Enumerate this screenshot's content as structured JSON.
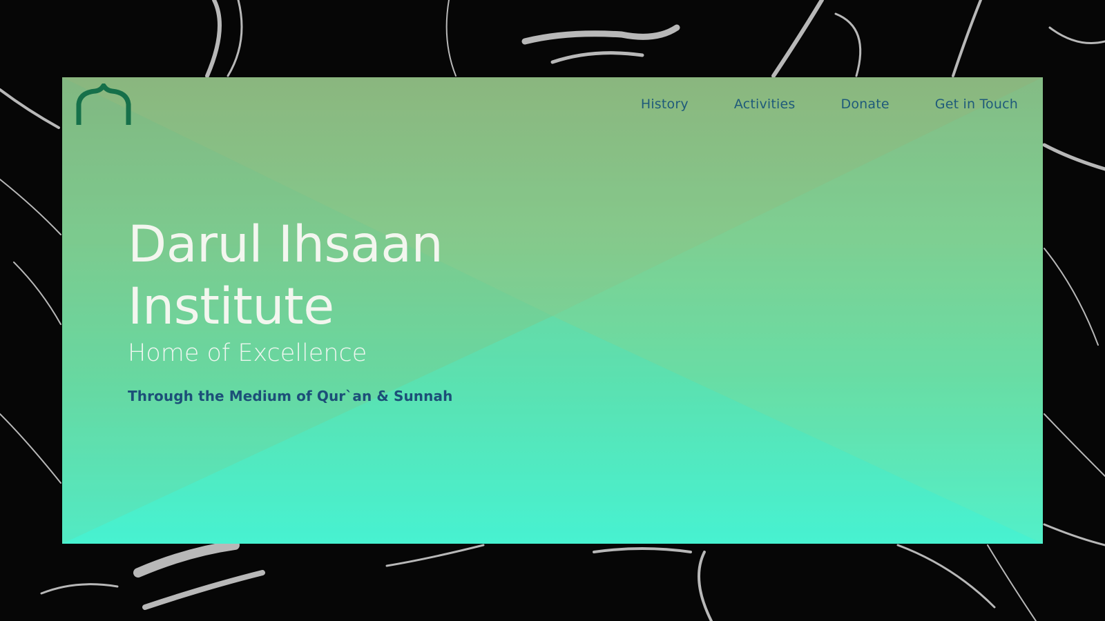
{
  "brand": {
    "logo_icon": "mosque-arch-icon",
    "logo_color": "#16704a"
  },
  "nav": {
    "items": [
      {
        "label": "History"
      },
      {
        "label": "Activities"
      },
      {
        "label": "Donate"
      },
      {
        "label": "Get in Touch"
      }
    ],
    "color": "#1f5a7a"
  },
  "hero": {
    "title_line1": "Darul Ihsaan",
    "title_line2": "Institute",
    "subtitle": "Home of Excellence",
    "tagline": "Through the Medium of Qur`an & Sunnah"
  },
  "theme": {
    "page_background": "black-marble",
    "gradient_top": "#86b880",
    "gradient_bottom": "#4cf5d0",
    "tagline_color": "#1c4f78"
  }
}
